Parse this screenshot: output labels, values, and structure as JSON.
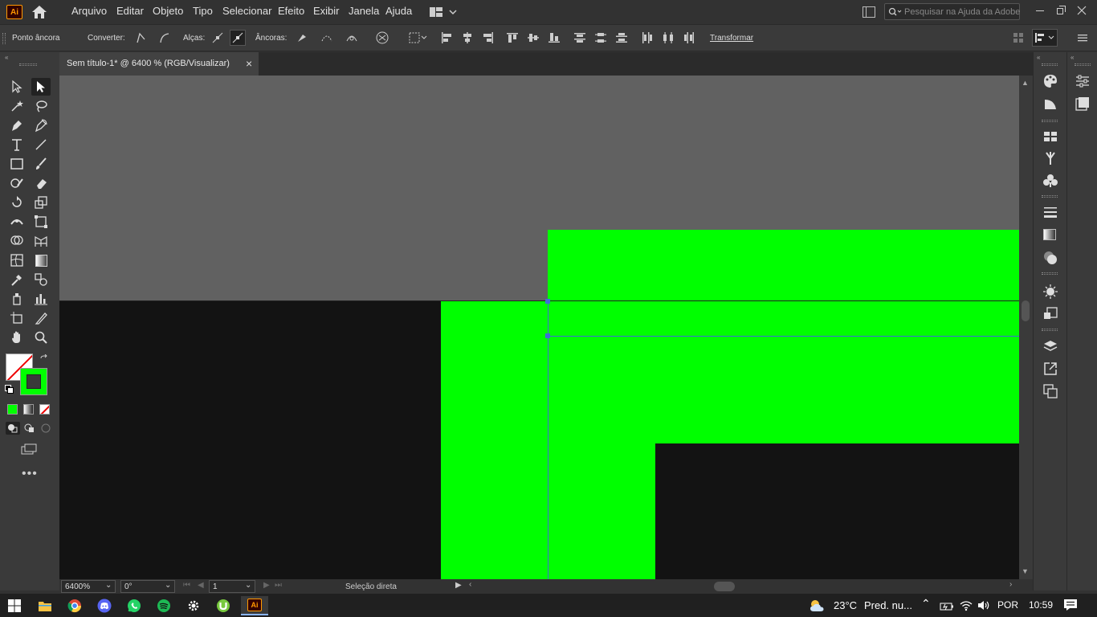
{
  "app": {
    "logo": "Ai"
  },
  "menu": {
    "items": [
      "Arquivo",
      "Editar",
      "Objeto",
      "Tipo",
      "Selecionar",
      "Efeito",
      "Exibir",
      "Janela",
      "Ajuda"
    ]
  },
  "search": {
    "placeholder": "Pesquisar na Ajuda da Adobe"
  },
  "control": {
    "anchor_label": "Ponto âncora",
    "convert_label": "Converter:",
    "handles_label": "Alças:",
    "anchors_label": "Âncoras:",
    "transform_label": "Transformar"
  },
  "document": {
    "tab_title": "Sem título-1* @ 6400 % (RGB/Visualizar)",
    "close": "×"
  },
  "status": {
    "zoom": "6400%",
    "rotation": "0°",
    "artboard": "1",
    "tool_name": "Seleção direta"
  },
  "colors": {
    "accent_green": "#00ff00",
    "canvas_gray": "#616161",
    "artwork_black": "#131313"
  },
  "taskbar": {
    "weather_temp": "23°C",
    "weather_text": "Pred. nu...",
    "lang": "POR",
    "time": "10:59",
    "apps": [
      "windows-icon",
      "file-explorer-icon",
      "chrome-icon",
      "discord-icon",
      "whatsapp-icon",
      "spotify-icon",
      "settings-icon",
      "utorrent-icon",
      "illustrator-icon"
    ]
  }
}
